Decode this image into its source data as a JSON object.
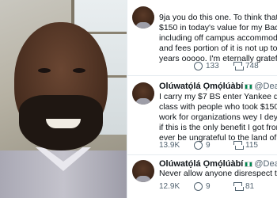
{
  "tweets": [
    {
      "name": "",
      "handle": "",
      "lines": [
        "9ja you do this one. To think that I spe",
        "$150 in today's value for my Bachelor",
        "including off campus accommodation",
        "and fees portion of it is not up to $7. I",
        "years ooooo. I'm eternally grateful an"
      ],
      "replies": "133",
      "retweets": "748",
      "likes": ""
    },
    {
      "name": "Olúwatọ́lá Ọmọ́lúàbí",
      "handle": "@DearSir_To",
      "lines": [
        "I carry my $7 BS enter Yankee do MS",
        "class with people who took $150k loa",
        "work for organizations wey I dey dream",
        "if this is the only benefit I got from 9j",
        "ever be ungrateful to the land of my b"
      ],
      "replies": "13.9K",
      "retweets": "9",
      "likes": "115"
    },
    {
      "name": "Olúwatọ́lá Ọmọ́lúàbí",
      "handle": "@DearSir_To",
      "lines": [
        "Never allow anyone disrespect this la"
      ],
      "replies": "12.9K",
      "retweets": "9",
      "likes": "81"
    }
  ]
}
